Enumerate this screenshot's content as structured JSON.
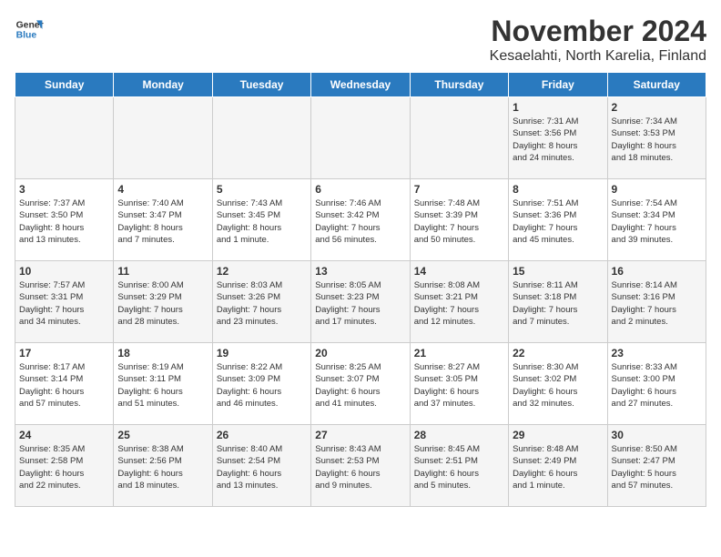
{
  "header": {
    "logo_line1": "General",
    "logo_line2": "Blue",
    "title": "November 2024",
    "subtitle": "Kesaelahti, North Karelia, Finland"
  },
  "days_of_week": [
    "Sunday",
    "Monday",
    "Tuesday",
    "Wednesday",
    "Thursday",
    "Friday",
    "Saturday"
  ],
  "weeks": [
    [
      {
        "day": "",
        "info": ""
      },
      {
        "day": "",
        "info": ""
      },
      {
        "day": "",
        "info": ""
      },
      {
        "day": "",
        "info": ""
      },
      {
        "day": "",
        "info": ""
      },
      {
        "day": "1",
        "info": "Sunrise: 7:31 AM\nSunset: 3:56 PM\nDaylight: 8 hours\nand 24 minutes."
      },
      {
        "day": "2",
        "info": "Sunrise: 7:34 AM\nSunset: 3:53 PM\nDaylight: 8 hours\nand 18 minutes."
      }
    ],
    [
      {
        "day": "3",
        "info": "Sunrise: 7:37 AM\nSunset: 3:50 PM\nDaylight: 8 hours\nand 13 minutes."
      },
      {
        "day": "4",
        "info": "Sunrise: 7:40 AM\nSunset: 3:47 PM\nDaylight: 8 hours\nand 7 minutes."
      },
      {
        "day": "5",
        "info": "Sunrise: 7:43 AM\nSunset: 3:45 PM\nDaylight: 8 hours\nand 1 minute."
      },
      {
        "day": "6",
        "info": "Sunrise: 7:46 AM\nSunset: 3:42 PM\nDaylight: 7 hours\nand 56 minutes."
      },
      {
        "day": "7",
        "info": "Sunrise: 7:48 AM\nSunset: 3:39 PM\nDaylight: 7 hours\nand 50 minutes."
      },
      {
        "day": "8",
        "info": "Sunrise: 7:51 AM\nSunset: 3:36 PM\nDaylight: 7 hours\nand 45 minutes."
      },
      {
        "day": "9",
        "info": "Sunrise: 7:54 AM\nSunset: 3:34 PM\nDaylight: 7 hours\nand 39 minutes."
      }
    ],
    [
      {
        "day": "10",
        "info": "Sunrise: 7:57 AM\nSunset: 3:31 PM\nDaylight: 7 hours\nand 34 minutes."
      },
      {
        "day": "11",
        "info": "Sunrise: 8:00 AM\nSunset: 3:29 PM\nDaylight: 7 hours\nand 28 minutes."
      },
      {
        "day": "12",
        "info": "Sunrise: 8:03 AM\nSunset: 3:26 PM\nDaylight: 7 hours\nand 23 minutes."
      },
      {
        "day": "13",
        "info": "Sunrise: 8:05 AM\nSunset: 3:23 PM\nDaylight: 7 hours\nand 17 minutes."
      },
      {
        "day": "14",
        "info": "Sunrise: 8:08 AM\nSunset: 3:21 PM\nDaylight: 7 hours\nand 12 minutes."
      },
      {
        "day": "15",
        "info": "Sunrise: 8:11 AM\nSunset: 3:18 PM\nDaylight: 7 hours\nand 7 minutes."
      },
      {
        "day": "16",
        "info": "Sunrise: 8:14 AM\nSunset: 3:16 PM\nDaylight: 7 hours\nand 2 minutes."
      }
    ],
    [
      {
        "day": "17",
        "info": "Sunrise: 8:17 AM\nSunset: 3:14 PM\nDaylight: 6 hours\nand 57 minutes."
      },
      {
        "day": "18",
        "info": "Sunrise: 8:19 AM\nSunset: 3:11 PM\nDaylight: 6 hours\nand 51 minutes."
      },
      {
        "day": "19",
        "info": "Sunrise: 8:22 AM\nSunset: 3:09 PM\nDaylight: 6 hours\nand 46 minutes."
      },
      {
        "day": "20",
        "info": "Sunrise: 8:25 AM\nSunset: 3:07 PM\nDaylight: 6 hours\nand 41 minutes."
      },
      {
        "day": "21",
        "info": "Sunrise: 8:27 AM\nSunset: 3:05 PM\nDaylight: 6 hours\nand 37 minutes."
      },
      {
        "day": "22",
        "info": "Sunrise: 8:30 AM\nSunset: 3:02 PM\nDaylight: 6 hours\nand 32 minutes."
      },
      {
        "day": "23",
        "info": "Sunrise: 8:33 AM\nSunset: 3:00 PM\nDaylight: 6 hours\nand 27 minutes."
      }
    ],
    [
      {
        "day": "24",
        "info": "Sunrise: 8:35 AM\nSunset: 2:58 PM\nDaylight: 6 hours\nand 22 minutes."
      },
      {
        "day": "25",
        "info": "Sunrise: 8:38 AM\nSunset: 2:56 PM\nDaylight: 6 hours\nand 18 minutes."
      },
      {
        "day": "26",
        "info": "Sunrise: 8:40 AM\nSunset: 2:54 PM\nDaylight: 6 hours\nand 13 minutes."
      },
      {
        "day": "27",
        "info": "Sunrise: 8:43 AM\nSunset: 2:53 PM\nDaylight: 6 hours\nand 9 minutes."
      },
      {
        "day": "28",
        "info": "Sunrise: 8:45 AM\nSunset: 2:51 PM\nDaylight: 6 hours\nand 5 minutes."
      },
      {
        "day": "29",
        "info": "Sunrise: 8:48 AM\nSunset: 2:49 PM\nDaylight: 6 hours\nand 1 minute."
      },
      {
        "day": "30",
        "info": "Sunrise: 8:50 AM\nSunset: 2:47 PM\nDaylight: 5 hours\nand 57 minutes."
      }
    ]
  ]
}
